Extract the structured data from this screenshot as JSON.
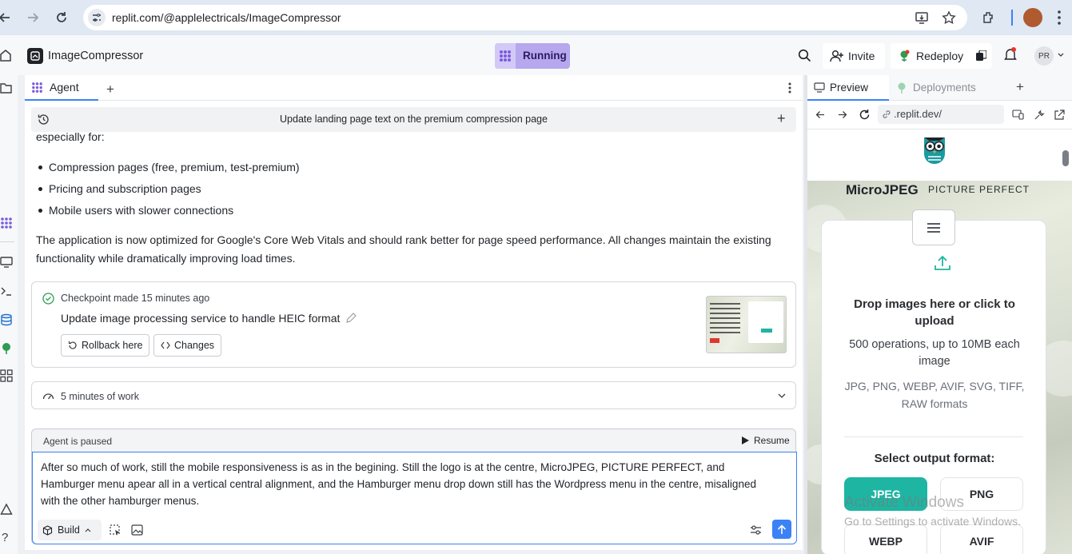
{
  "browser": {
    "url": "replit.com/@applelectricals/ImageCompressor"
  },
  "header": {
    "project_name": "ImageCompressor",
    "run_status": "Running",
    "invite_label": "Invite",
    "redeploy_label": "Redeploy",
    "avatar_initials": "PR"
  },
  "agent": {
    "tab_label": "Agent",
    "task_title": "Update landing page text on the premium compression page",
    "intro_tail": "especially for:",
    "bullets": [
      "Compression pages (free, premium, test-premium)",
      "Pricing and subscription pages",
      "Mobile users with slower connections"
    ],
    "summary": "The application is now optimized for Google's Core Web Vitals and should rank better for page speed performance. All changes maintain the existing functionality while dramatically improving load times.",
    "checkpoint": {
      "time": "Checkpoint made 15 minutes ago",
      "title": "Update image processing service to handle HEIC format",
      "rollback_label": "Rollback here",
      "changes_label": "Changes"
    },
    "work_summary": "5 minutes of work",
    "paused_label": "Agent is paused",
    "resume_label": "Resume",
    "input_text": "After so much of work, still the mobile responsiveness is as in the begining. Still the logo is at the centre, MicroJPEG, PICTURE PERFECT, and Hamburger menu apear all in a vertical central alignment, and the Hamburger menu drop down still has the Wordpress menu in the centre, misaligned with the other hamburger menus.",
    "mode_label": "Build"
  },
  "preview": {
    "tab_preview": "Preview",
    "tab_deployments": "Deployments",
    "address": ".replit.dev/",
    "brand": "MicroJPEG",
    "tagline": "PICTURE PERFECT",
    "drop_text": "Drop images here or click to upload",
    "limits_text": "500 operations, up to 10MB each image",
    "formats_text": "JPG, PNG, WEBP, AVIF, SVG, TIFF, RAW formats",
    "select_format": "Select output format:",
    "formats": [
      "JPEG",
      "PNG",
      "WEBP",
      "AVIF"
    ]
  },
  "os": {
    "watermark_title": "Activate Windows",
    "watermark_sub": "Go to Settings to activate Windows."
  },
  "colors": {
    "accent_blue": "#3b82f6",
    "running_bg": "#b6a7ef",
    "jpeg_teal": "#1fb5a3"
  }
}
